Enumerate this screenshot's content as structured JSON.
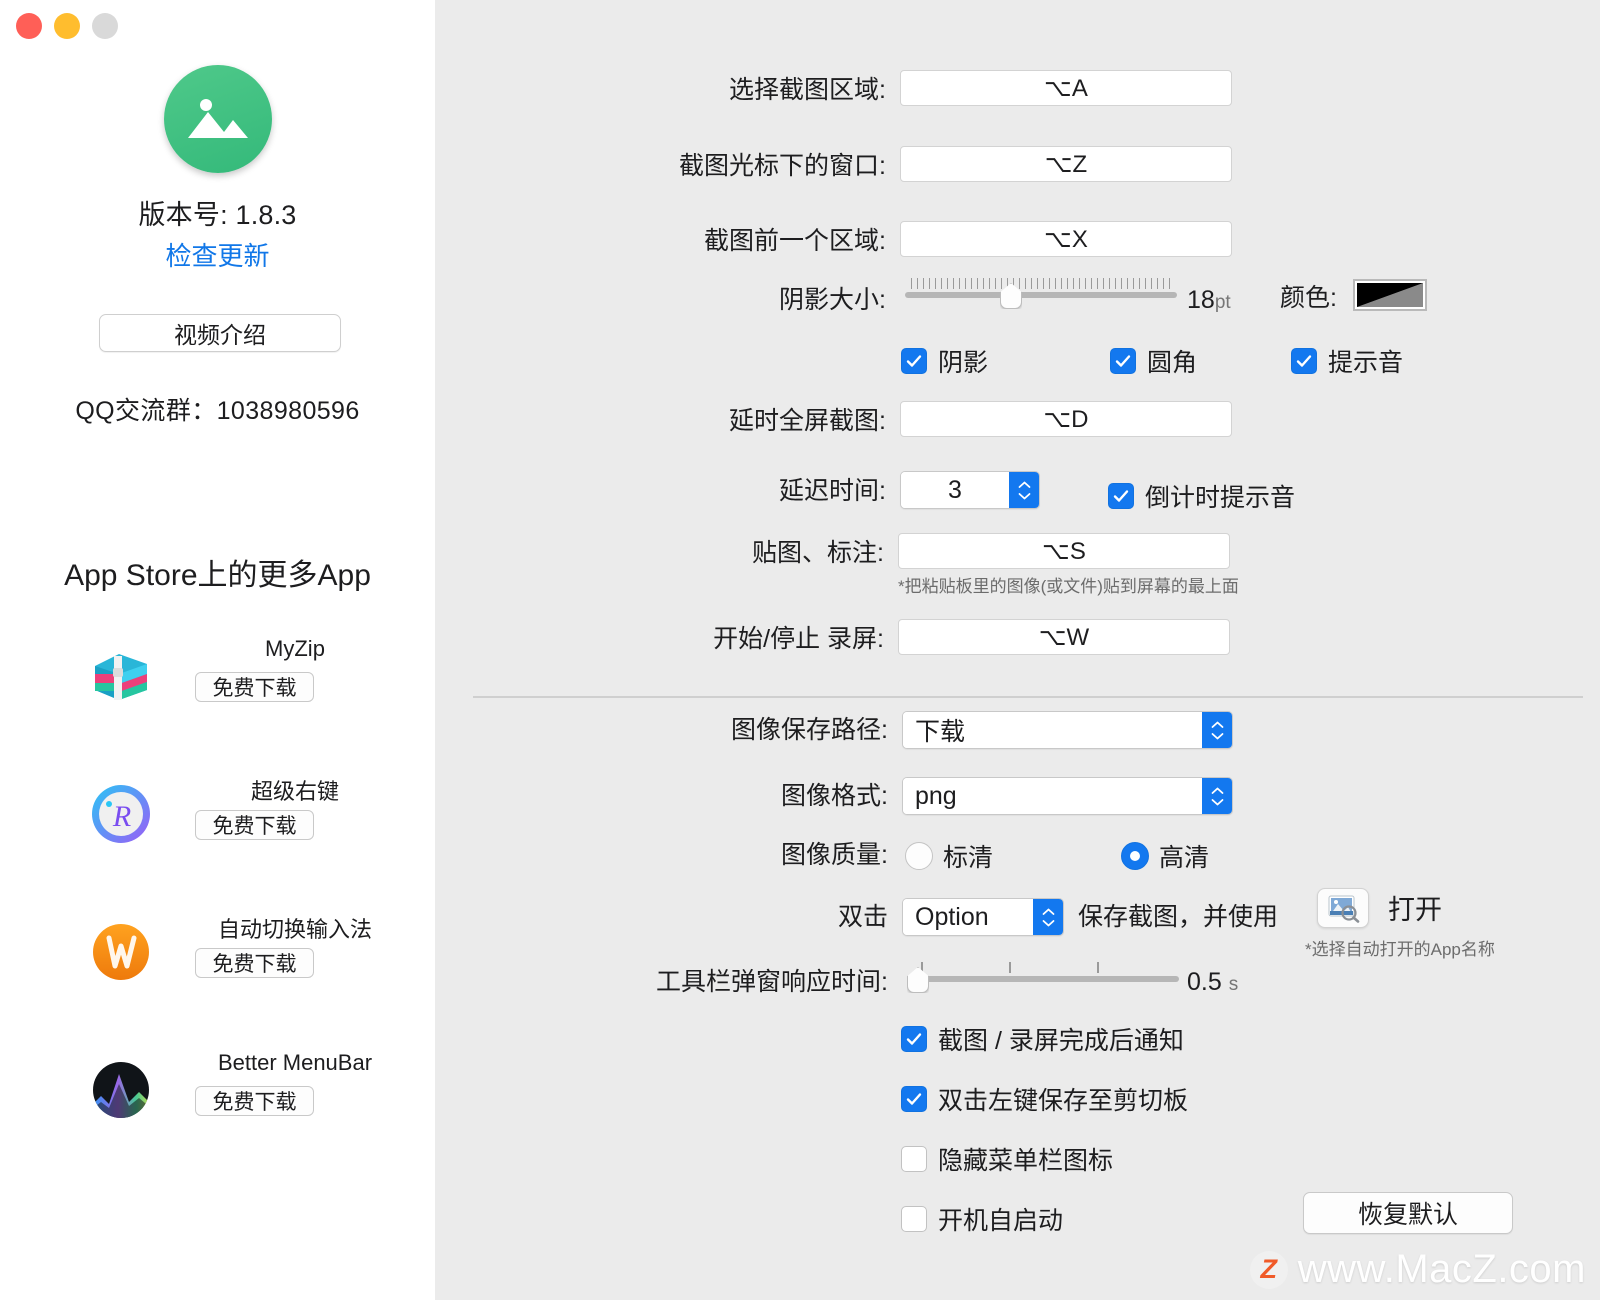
{
  "window": {
    "traffic_lights": [
      "close",
      "minimize",
      "zoom-disabled"
    ]
  },
  "sidebar": {
    "app_icon": "photo-icon",
    "version_label": "版本号: 1.8.3",
    "check_update_label": "检查更新",
    "video_button_label": "视频介绍",
    "qq_group_label": "QQ交流群：1038980596",
    "more_apps_title": "App Store上的更多App",
    "download_label": "免费下载",
    "apps": [
      {
        "name": "MyZip",
        "icon": "zip-archive-icon",
        "download": "免费下载"
      },
      {
        "name": "超级右键",
        "icon": "right-click-icon",
        "download": "免费下载"
      },
      {
        "name": "自动切换输入法",
        "icon": "input-method-icon",
        "download": "免费下载"
      },
      {
        "name": "Better MenuBar",
        "icon": "menubar-icon",
        "download": "免费下载"
      }
    ]
  },
  "settings": {
    "shortcuts": [
      {
        "label": "选择截图区域:",
        "value": "⌥A"
      },
      {
        "label": "截图光标下的窗口:",
        "value": "⌥Z"
      },
      {
        "label": "截图前一个区域:",
        "value": "⌥X"
      }
    ],
    "shadow_size": {
      "label": "阴影大小:",
      "value": "18",
      "unit": "pt",
      "min": 0,
      "max": 40,
      "percent": 45
    },
    "color": {
      "label": "颜色:",
      "swatch_from": "#000000",
      "swatch_to": "#8a8a8a"
    },
    "toggles_row1": [
      {
        "label": "阴影",
        "checked": true
      },
      {
        "label": "圆角",
        "checked": true
      },
      {
        "label": "提示音",
        "checked": true
      }
    ],
    "delay_fullscreen": {
      "label": "延时全屏截图:",
      "value": "⌥D"
    },
    "delay_time": {
      "label": "延迟时间:",
      "value": "3"
    },
    "countdown_sound": {
      "label": "倒计时提示音",
      "checked": true
    },
    "pin_annotate": {
      "label": "贴图、标注:",
      "value": "⌥S",
      "hint": "*把粘贴板里的图像(或文件)贴到屏幕的最上面"
    },
    "record": {
      "label": "开始/停止 录屏:",
      "value": "⌥W"
    },
    "save_path": {
      "label": "图像保存路径:",
      "value": "下载"
    },
    "image_format": {
      "label": "图像格式:",
      "value": "png"
    },
    "image_quality": {
      "label": "图像质量:",
      "options": [
        {
          "label": "标清",
          "selected": false
        },
        {
          "label": "高清",
          "selected": true
        }
      ]
    },
    "double_click": {
      "prefix_label": "双击",
      "modifier": "Option",
      "mid_label": "保存截图，并使用",
      "open_label": "打开",
      "app_icon": "preview-app-icon",
      "hint": "*选择自动打开的App名称"
    },
    "toolbar_delay": {
      "label": "工具栏弹窗响应时间:",
      "value": "0.5",
      "unit": "s",
      "percent": 2
    },
    "checkboxes": [
      {
        "label": "截图 / 录屏完成后通知",
        "checked": true
      },
      {
        "label": "双击左键保存至剪切板",
        "checked": true
      },
      {
        "label": "隐藏菜单栏图标",
        "checked": false
      },
      {
        "label": "开机自启动",
        "checked": false
      }
    ],
    "restore_defaults_label": "恢复默认"
  },
  "watermark": {
    "badge": "Z",
    "text": "www.MacZ.com"
  },
  "colors": {
    "accent": "#1378ef",
    "link": "#1177e8",
    "panel_bg": "#ebebeb",
    "sidebar_bg": "#ffffff",
    "app_icon_green": "#34b97a"
  }
}
